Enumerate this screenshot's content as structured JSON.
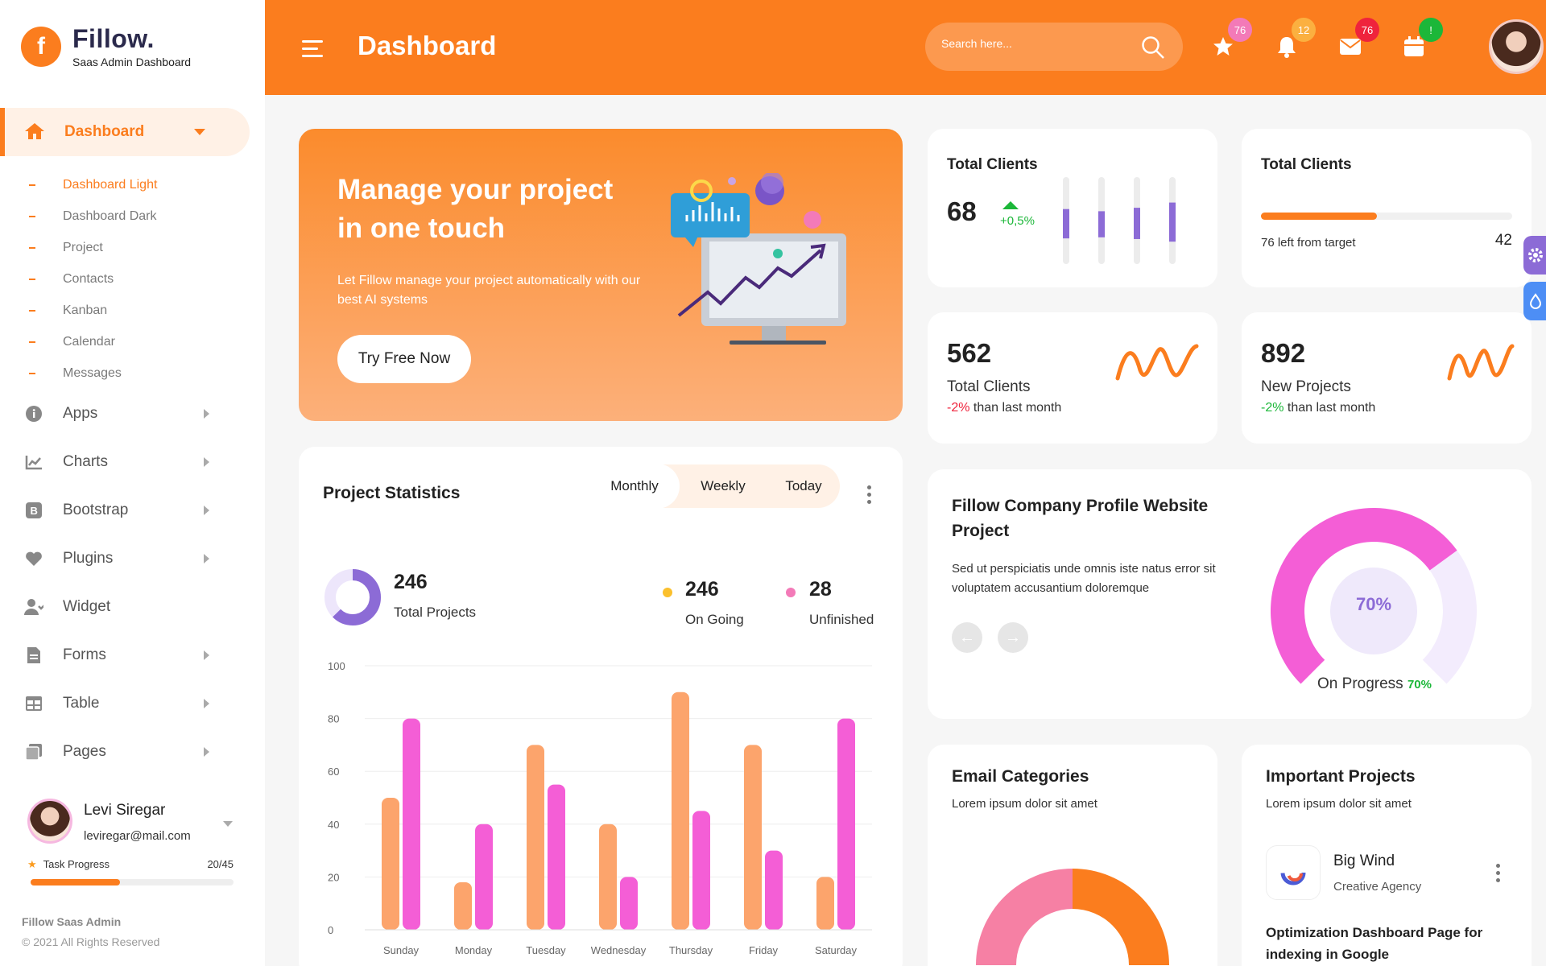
{
  "brand": {
    "name": "Fillow.",
    "subtitle": "Saas Admin Dashboard",
    "mark": "f"
  },
  "sidebar": {
    "active": {
      "label": "Dashboard"
    },
    "submenu": [
      {
        "label": "Dashboard Light",
        "active": true
      },
      {
        "label": "Dashboard Dark",
        "active": false
      },
      {
        "label": "Project",
        "active": false
      },
      {
        "label": "Contacts",
        "active": false
      },
      {
        "label": "Kanban",
        "active": false
      },
      {
        "label": "Calendar",
        "active": false
      },
      {
        "label": "Messages",
        "active": false
      }
    ],
    "menu": [
      {
        "label": "Apps",
        "icon": "info-icon",
        "arrow": true
      },
      {
        "label": "Charts",
        "icon": "chart-icon",
        "arrow": true
      },
      {
        "label": "Bootstrap",
        "icon": "bootstrap-icon",
        "arrow": true
      },
      {
        "label": "Plugins",
        "icon": "heart-icon",
        "arrow": true
      },
      {
        "label": "Widget",
        "icon": "user-check-icon",
        "arrow": false
      },
      {
        "label": "Forms",
        "icon": "file-icon",
        "arrow": true
      },
      {
        "label": "Table",
        "icon": "table-icon",
        "arrow": true
      },
      {
        "label": "Pages",
        "icon": "pages-icon",
        "arrow": true
      }
    ],
    "user": {
      "name": "Levi Siregar",
      "email": "leviregar@mail.com"
    },
    "task": {
      "label": "Task Progress",
      "value": "20/45",
      "progress": 0.44
    },
    "footer": {
      "title": "Fillow Saas Admin",
      "copyright": "© 2021 All Rights Reserved"
    }
  },
  "header": {
    "title": "Dashboard",
    "search_placeholder": "Search here...",
    "badges": [
      {
        "icon": "star-icon",
        "count": "76",
        "color": "#f37ab8"
      },
      {
        "icon": "bell-icon",
        "count": "12",
        "color": "#fbb040"
      },
      {
        "icon": "mail-icon",
        "count": "76",
        "color": "#ef233c"
      },
      {
        "icon": "calendar-icon",
        "count": "!",
        "color": "#1cb739"
      }
    ]
  },
  "hero": {
    "title": "Manage your project in one touch",
    "text": "Let Fillow manage your project automatically with our best AI systems",
    "button": "Try Free Now"
  },
  "cards": {
    "total_clients_a": {
      "title": "Total Clients",
      "value": "68",
      "change": "+0,5%",
      "bar_levels": [
        0.45,
        0.4,
        0.48,
        0.6
      ]
    },
    "total_clients_b": {
      "title": "Total Clients",
      "note": "76 left from target",
      "value": "42",
      "progress": 0.46
    },
    "total_clients_c": {
      "value": "562",
      "label": "Total Clients",
      "change": "-2%",
      "suffix": "than last month"
    },
    "new_projects": {
      "value": "892",
      "label": "New Projects",
      "change": "-2%",
      "suffix": "than last month"
    }
  },
  "project_stats": {
    "title": "Project Statistics",
    "tabs": [
      "Monthly",
      "Weekly",
      "Today"
    ],
    "active_tab": "Monthly",
    "total": {
      "value": "246",
      "label": "Total Projects"
    },
    "ongoing": {
      "value": "246",
      "label": "On Going",
      "color": "#fbc02d"
    },
    "unfinished": {
      "value": "28",
      "label": "Unfinished",
      "color": "#f37ab8"
    }
  },
  "chart_data": {
    "type": "bar",
    "categories": [
      "Sunday",
      "Monday",
      "Tuesday",
      "Wednesday",
      "Thursday",
      "Friday",
      "Saturday"
    ],
    "series": [
      {
        "values": [
          50,
          18,
          70,
          40,
          90,
          70,
          20
        ],
        "color": "#fca46c"
      },
      {
        "values": [
          80,
          40,
          55,
          20,
          45,
          30,
          80
        ],
        "color": "#f45ed6"
      }
    ],
    "ylim": [
      0,
      100
    ],
    "yticks": [
      0,
      20,
      40,
      60,
      80,
      100
    ],
    "grid": true
  },
  "company": {
    "title": "Fillow Company Profile Website Project",
    "text": "Sed ut perspiciatis unde omnis iste natus error sit voluptatem accusantium doloremque",
    "percent": "70%",
    "status": "On Progress",
    "status_value": "70%",
    "progress": 0.7
  },
  "email_categories": {
    "title": "Email Categories",
    "subtitle": "Lorem ipsum dolor sit amet"
  },
  "important_projects": {
    "title": "Important Projects",
    "subtitle": "Lorem ipsum dolor sit amet",
    "item": {
      "name": "Big Wind",
      "company": "Creative Agency",
      "task": "Optimization Dashboard Page for indexing in Google"
    }
  },
  "colors": {
    "accent": "#fb7d1e",
    "purple": "#8c6bd6",
    "pink": "#f45ed6",
    "green": "#1cb739",
    "red": "#ef233c"
  }
}
